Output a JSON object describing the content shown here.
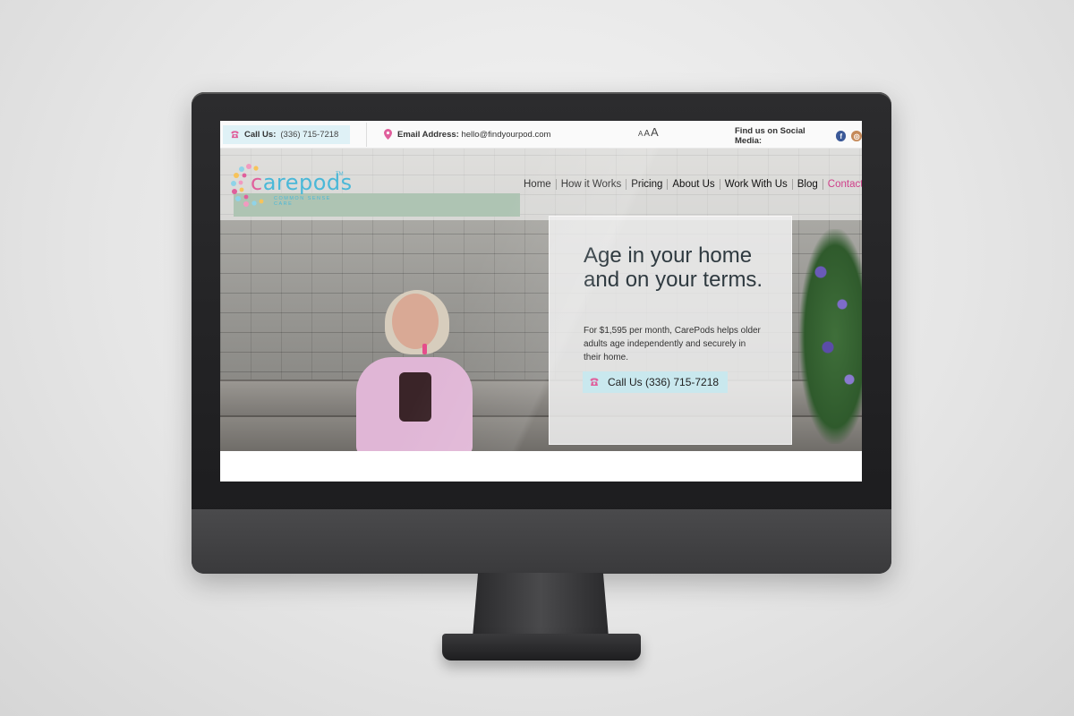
{
  "topbar": {
    "call_label": "Call Us:",
    "call_number": "(336) 715-7218",
    "email_label": "Email Address:",
    "email_value": "hello@findyourpod.com",
    "font_small": "A",
    "font_medium": "A",
    "font_large": "A",
    "social_label": "Find us on Social Media:",
    "facebook_glyph": "f",
    "instagram_glyph": "◎"
  },
  "logo": {
    "word_c": "c",
    "word_rest": "arepods",
    "tm": "TM",
    "tagline": "COMMON SENSE CARE"
  },
  "nav": {
    "items": [
      "Home",
      "How it Works",
      "Pricing",
      "About Us",
      "Work With Us",
      "Blog",
      "Contact Us"
    ]
  },
  "hero": {
    "heading": "Age in your home and on your terms.",
    "body": "For $1,595 per month, CarePods helps older adults age independently and securely in their home.",
    "cta_label": "Call Us (336) 715-7218"
  },
  "icons": {
    "phone": "phone-icon",
    "pin": "map-pin-icon",
    "facebook": "facebook-icon",
    "instagram": "instagram-icon"
  },
  "colors": {
    "brand_pink": "#e05f9c",
    "brand_blue": "#4ab8d8",
    "chip_bg": "#dff1f6",
    "cta_bg": "#c9e8ee",
    "contact_link": "#cf3f8a"
  }
}
